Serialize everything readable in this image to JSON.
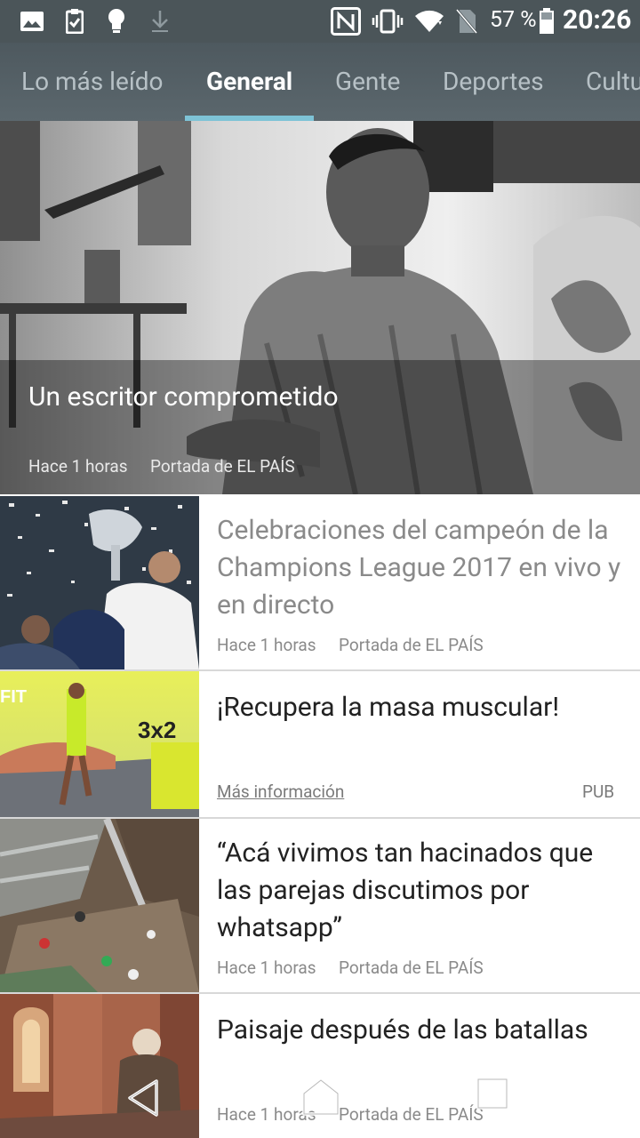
{
  "status_bar": {
    "battery_percent": "57 %",
    "time": "20:26",
    "icons": [
      "image-icon",
      "clipboard-check-icon",
      "lightbulb-icon",
      "download-icon",
      "nfc-icon",
      "vibrate-icon",
      "wifi-icon",
      "no-sim-icon",
      "battery-icon"
    ]
  },
  "tabs": [
    {
      "label": "Lo más leído",
      "active": false
    },
    {
      "label": "General",
      "active": true
    },
    {
      "label": "Gente",
      "active": false
    },
    {
      "label": "Deportes",
      "active": false
    },
    {
      "label": "Cultura",
      "active": false
    }
  ],
  "hero": {
    "title": "Un escritor comprometido",
    "time": "Hace 1 horas",
    "source": "Portada de EL PAÍS"
  },
  "articles": [
    {
      "title": "Celebraciones del campeón de la Champions League 2017 en vivo y en directo",
      "time": "Hace 1 horas",
      "source": "Portada de EL PAÍS",
      "read": true
    },
    {
      "title": "¡Recupera la masa muscular!",
      "link": "Más información",
      "badge": "PUB",
      "ad_promo": "3x2",
      "ad_brand": "FIT"
    },
    {
      "title": "“Acá vivimos tan hacinados que las parejas discutimos por whatsapp”",
      "time": "Hace 1 horas",
      "source": "Portada de EL PAÍS",
      "read": false
    },
    {
      "title": "Paisaje después de las batallas",
      "time": "Hace 1 horas",
      "source": "Portada de EL PAÍS",
      "read": false
    }
  ],
  "nav_bar": {
    "icons": [
      "back-icon",
      "home-icon",
      "recents-icon"
    ]
  },
  "colors": {
    "status_bar": "#4b5559",
    "tab_bar": "#55616a",
    "tab_indicator": "#7ec3d6",
    "read_title": "#8a8a8a",
    "title": "#222222"
  }
}
